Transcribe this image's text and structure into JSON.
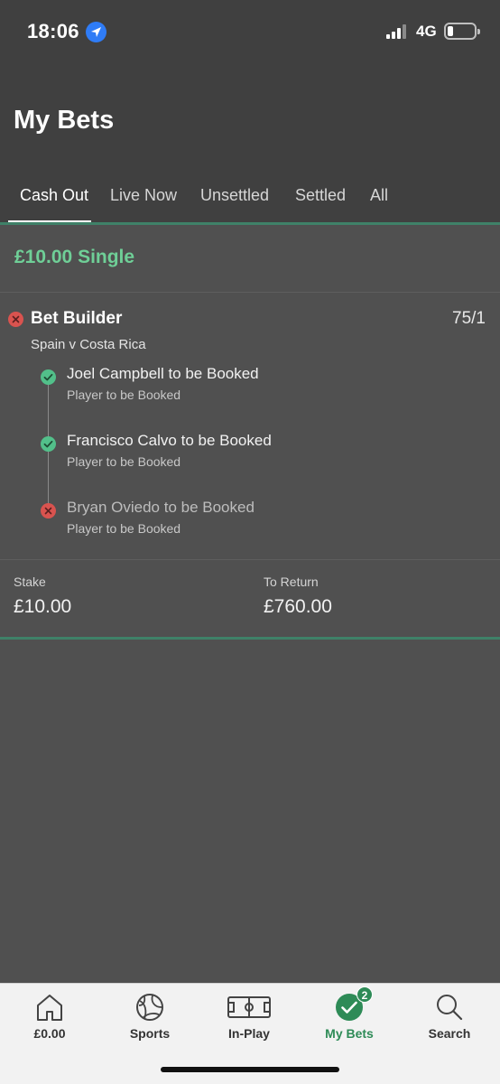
{
  "status_bar": {
    "time": "18:06",
    "network": "4G"
  },
  "page": {
    "title": "My Bets"
  },
  "tabs": [
    {
      "label": "Cash Out",
      "active": true
    },
    {
      "label": "Live Now",
      "active": false
    },
    {
      "label": "Unsettled",
      "active": false
    },
    {
      "label": "Settled",
      "active": false
    },
    {
      "label": "All",
      "active": false
    }
  ],
  "bet": {
    "type": "£10.00 Single",
    "builder_title": "Bet Builder",
    "odds": "75/1",
    "event": "Spain v Costa Rica",
    "legs": [
      {
        "title": "Joel Campbell to be Booked",
        "market": "Player to be Booked",
        "status": "won"
      },
      {
        "title": "Francisco Calvo to be Booked",
        "market": "Player to be Booked",
        "status": "won"
      },
      {
        "title": "Bryan Oviedo to be Booked",
        "market": "Player to be Booked",
        "status": "lost"
      }
    ],
    "stake_label": "Stake",
    "stake": "£10.00",
    "return_label": "To Return",
    "return": "£760.00"
  },
  "bottom_nav": [
    {
      "label": "£0.00",
      "icon": "home-icon"
    },
    {
      "label": "Sports",
      "icon": "ball-icon"
    },
    {
      "label": "In-Play",
      "icon": "pitch-icon"
    },
    {
      "label": "My Bets",
      "icon": "check-circle-icon",
      "badge": "2",
      "active": true
    },
    {
      "label": "Search",
      "icon": "search-icon"
    }
  ],
  "colors": {
    "accent": "#6fcf97",
    "won": "#52c08a",
    "lost": "#d9534f",
    "nav_active": "#2e8b57"
  }
}
